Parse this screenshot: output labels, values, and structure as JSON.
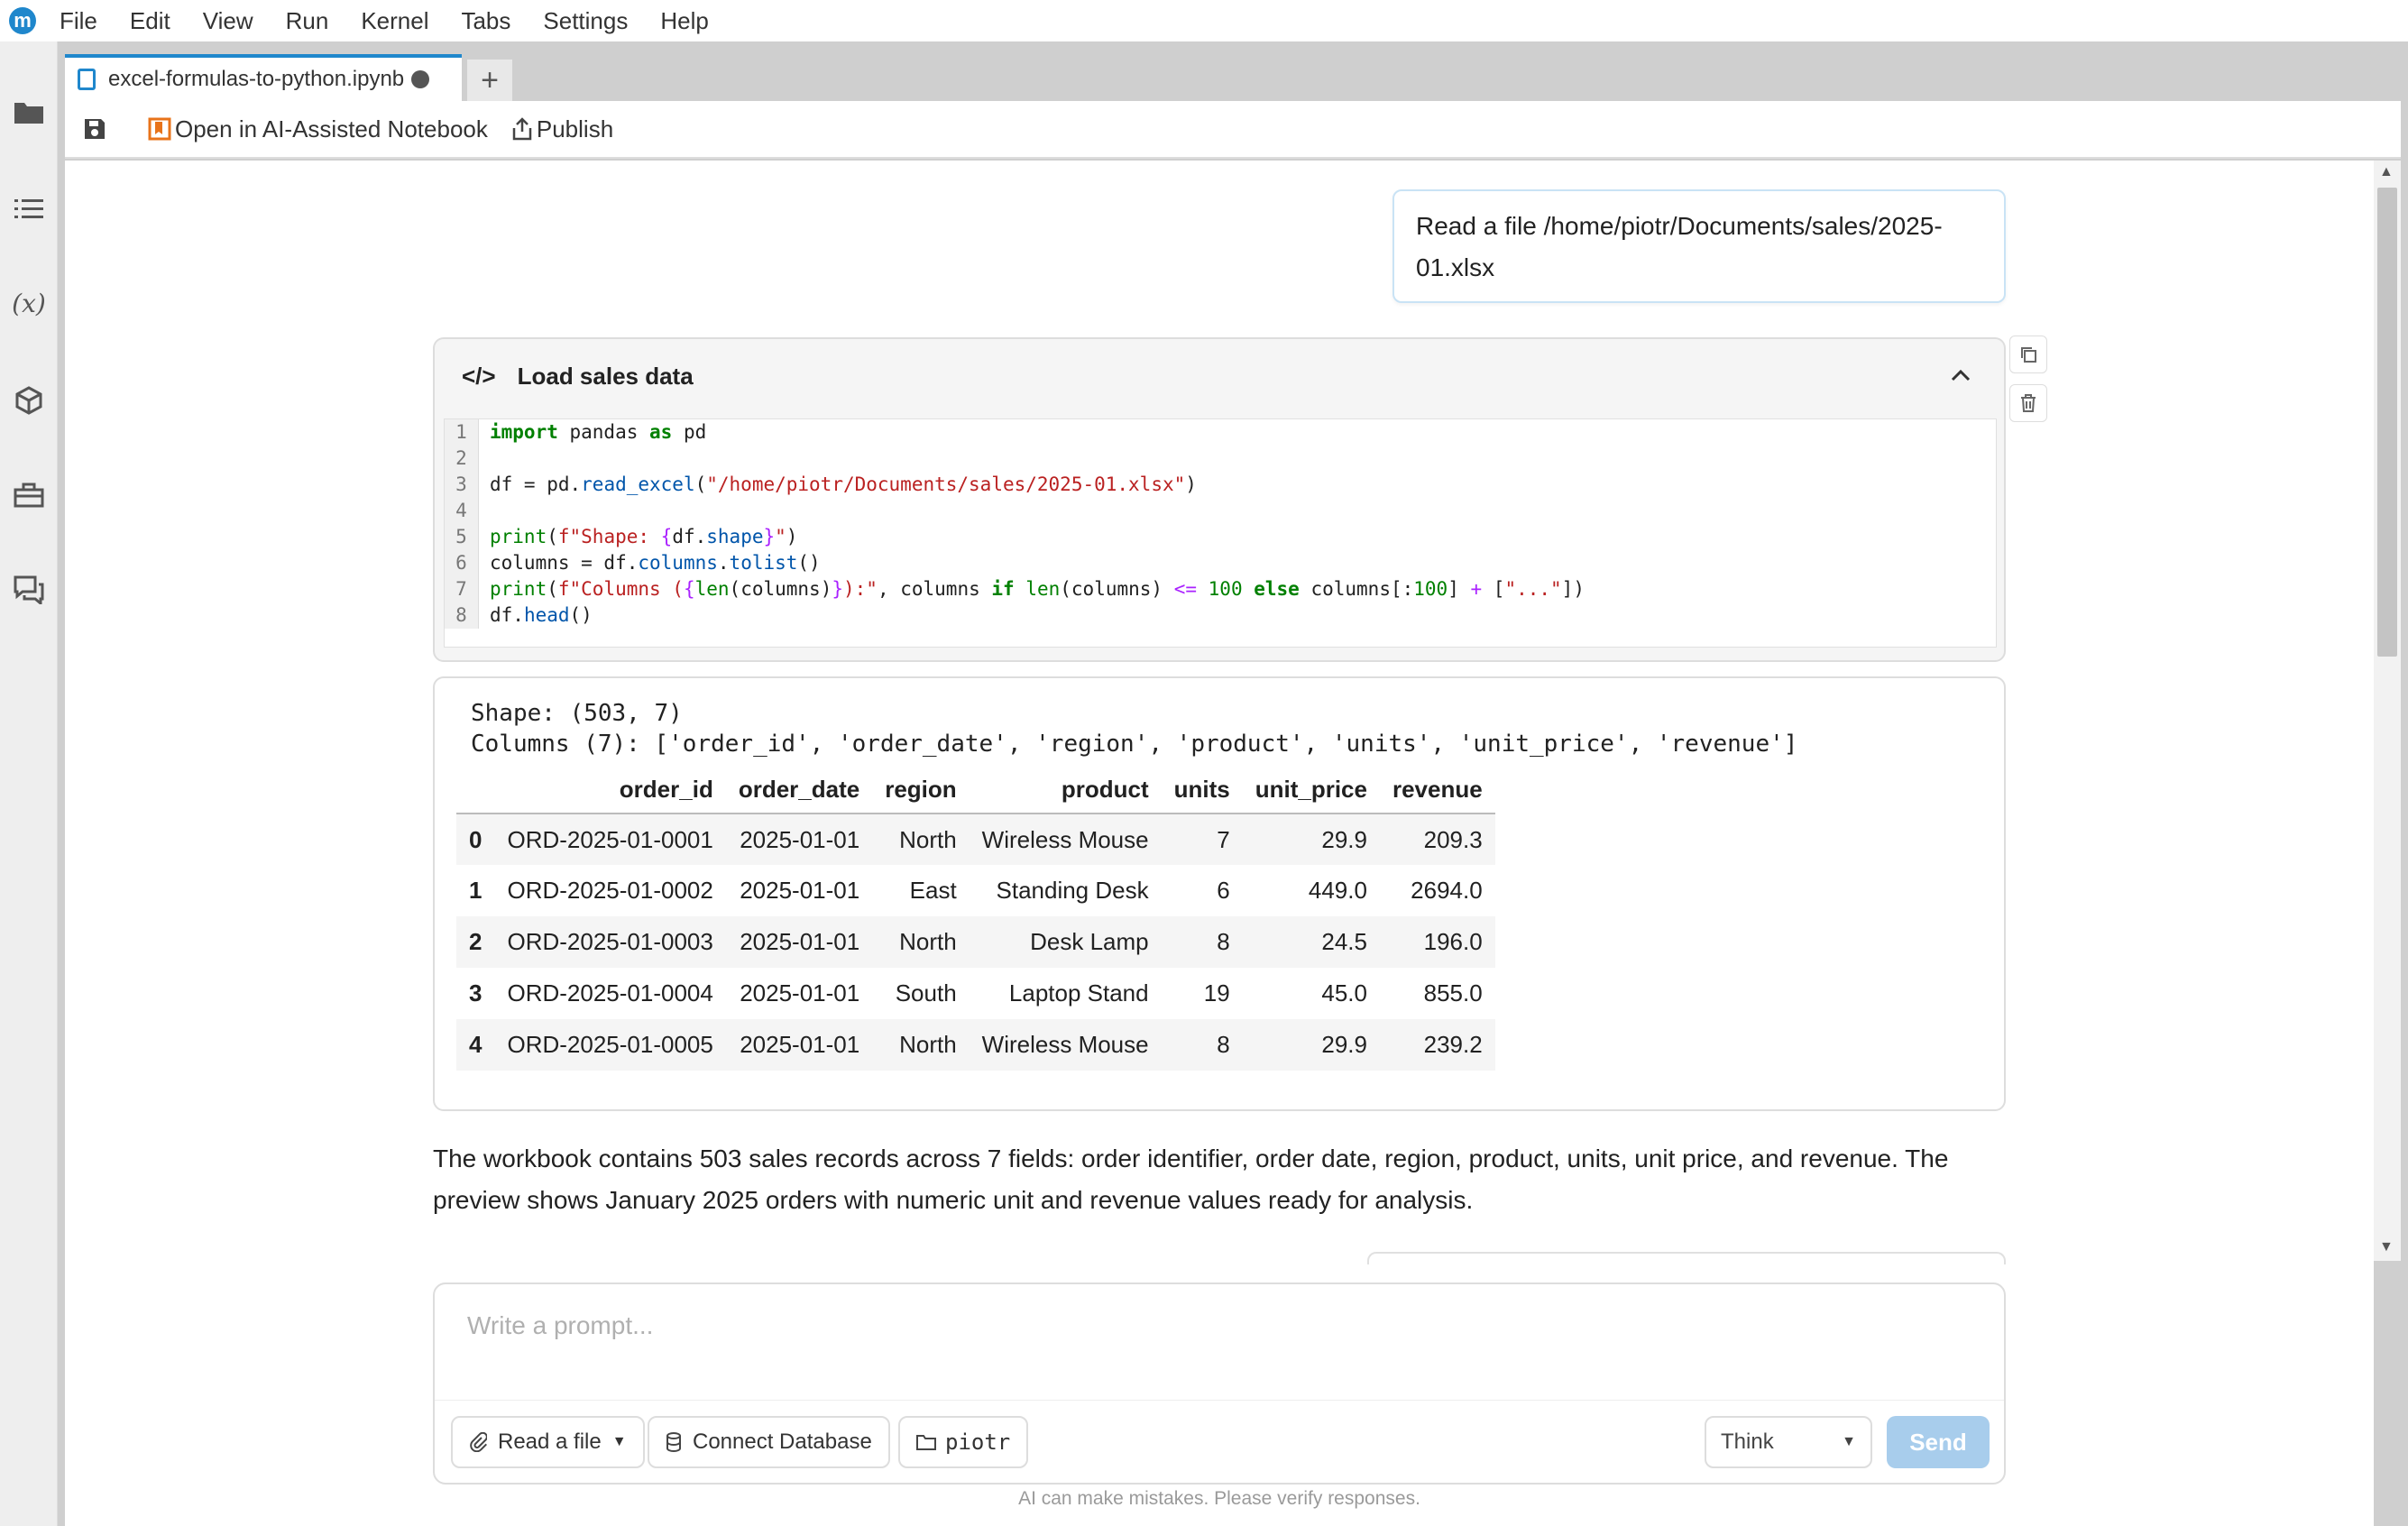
{
  "app": {
    "logo_letter": "m",
    "accent_color": "#1f87cc"
  },
  "menu": [
    "File",
    "Edit",
    "View",
    "Run",
    "Kernel",
    "Tabs",
    "Settings",
    "Help"
  ],
  "sidebar_icons": [
    "folder-icon",
    "list-icon",
    "variables-icon",
    "package-icon",
    "toolbox-icon",
    "chat-icon"
  ],
  "sidebar_variable_label": "(x)",
  "tab": {
    "title": "excel-formulas-to-python.ipynb",
    "new_tab": "+"
  },
  "toolbar": {
    "open_ai": "Open in AI-Assisted Notebook",
    "publish": "Publish"
  },
  "user_message": "Read a file /home/piotr/Documents/sales/2025-01.xlsx",
  "cell": {
    "title": "Load sales data",
    "code_icon": "</>",
    "line_numbers": [
      "1",
      "2",
      "3",
      "4",
      "5",
      "6",
      "7",
      "8"
    ]
  },
  "output": {
    "text": "Shape: (503, 7)\nColumns (7): ['order_id', 'order_date', 'region', 'product', 'units', 'unit_price', 'revenue']",
    "columns": [
      "",
      "order_id",
      "order_date",
      "region",
      "product",
      "units",
      "unit_price",
      "revenue"
    ],
    "rows": [
      [
        "0",
        "ORD-2025-01-0001",
        "2025-01-01",
        "North",
        "Wireless Mouse",
        "7",
        "29.9",
        "209.3"
      ],
      [
        "1",
        "ORD-2025-01-0002",
        "2025-01-01",
        "East",
        "Standing Desk",
        "6",
        "449.0",
        "2694.0"
      ],
      [
        "2",
        "ORD-2025-01-0003",
        "2025-01-01",
        "North",
        "Desk Lamp",
        "8",
        "24.5",
        "196.0"
      ],
      [
        "3",
        "ORD-2025-01-0004",
        "2025-01-01",
        "South",
        "Laptop Stand",
        "19",
        "45.0",
        "855.0"
      ],
      [
        "4",
        "ORD-2025-01-0005",
        "2025-01-01",
        "North",
        "Wireless Mouse",
        "8",
        "29.9",
        "239.2"
      ]
    ]
  },
  "summary": "The workbook contains 503 sales records across 7 fields: order identifier, order date, region, product, units, unit price, and revenue. The preview shows January 2025 orders with numeric unit and revenue values ready for analysis.",
  "prompt": {
    "placeholder": "Write a prompt...",
    "read_file": "Read a file",
    "connect_db": "Connect Database",
    "folder": "piotr",
    "mode": "Think",
    "send": "Send",
    "disclaimer": "AI can make mistakes. Please verify responses."
  }
}
